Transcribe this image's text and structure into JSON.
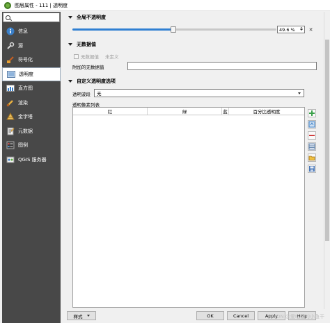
{
  "window": {
    "title": "图层属性 - 111 | 透明度"
  },
  "sidebar": {
    "items": [
      {
        "label": "信息",
        "icon": "info-icon",
        "active": false
      },
      {
        "label": "源",
        "icon": "wrench-icon",
        "active": false
      },
      {
        "label": "符号化",
        "icon": "paintbrush-icon",
        "active": false
      },
      {
        "label": "透明度",
        "icon": "transparency-icon",
        "active": true
      },
      {
        "label": "直方图",
        "icon": "histogram-icon",
        "active": false
      },
      {
        "label": "渲染",
        "icon": "brush-icon",
        "active": false
      },
      {
        "label": "金字塔",
        "icon": "pyramid-icon",
        "active": false
      },
      {
        "label": "元数据",
        "icon": "metadata-icon",
        "active": false
      },
      {
        "label": "图例",
        "icon": "legend-icon",
        "active": false
      },
      {
        "label": "QGIS 服务器",
        "icon": "server-icon",
        "active": false
      }
    ]
  },
  "global_opacity": {
    "header": "全局不透明度",
    "value_text": "49.6 %",
    "value_fraction": 0.496
  },
  "nodata": {
    "header": "无数据值",
    "checkbox_label": "无数据值",
    "undefined_text": "未定义",
    "additional_label": "附加的无数据值",
    "additional_value": ""
  },
  "custom": {
    "header": "自定义透明度选项",
    "band_label": "透明波段",
    "band_value": "无",
    "list_label": "透明像素列表",
    "columns": [
      "红",
      "绿",
      "蓝",
      "百分比透明度"
    ]
  },
  "footer": {
    "style_button": "样式",
    "ok_button": "OK",
    "cancel_button": "Cancel",
    "apply_button": "Apply",
    "help_button": "Help"
  },
  "watermark": "CSDN @爱吃猫的小鱼干",
  "colors": {
    "accent": "#2f7fd2",
    "sidebar_bg": "#484848"
  }
}
